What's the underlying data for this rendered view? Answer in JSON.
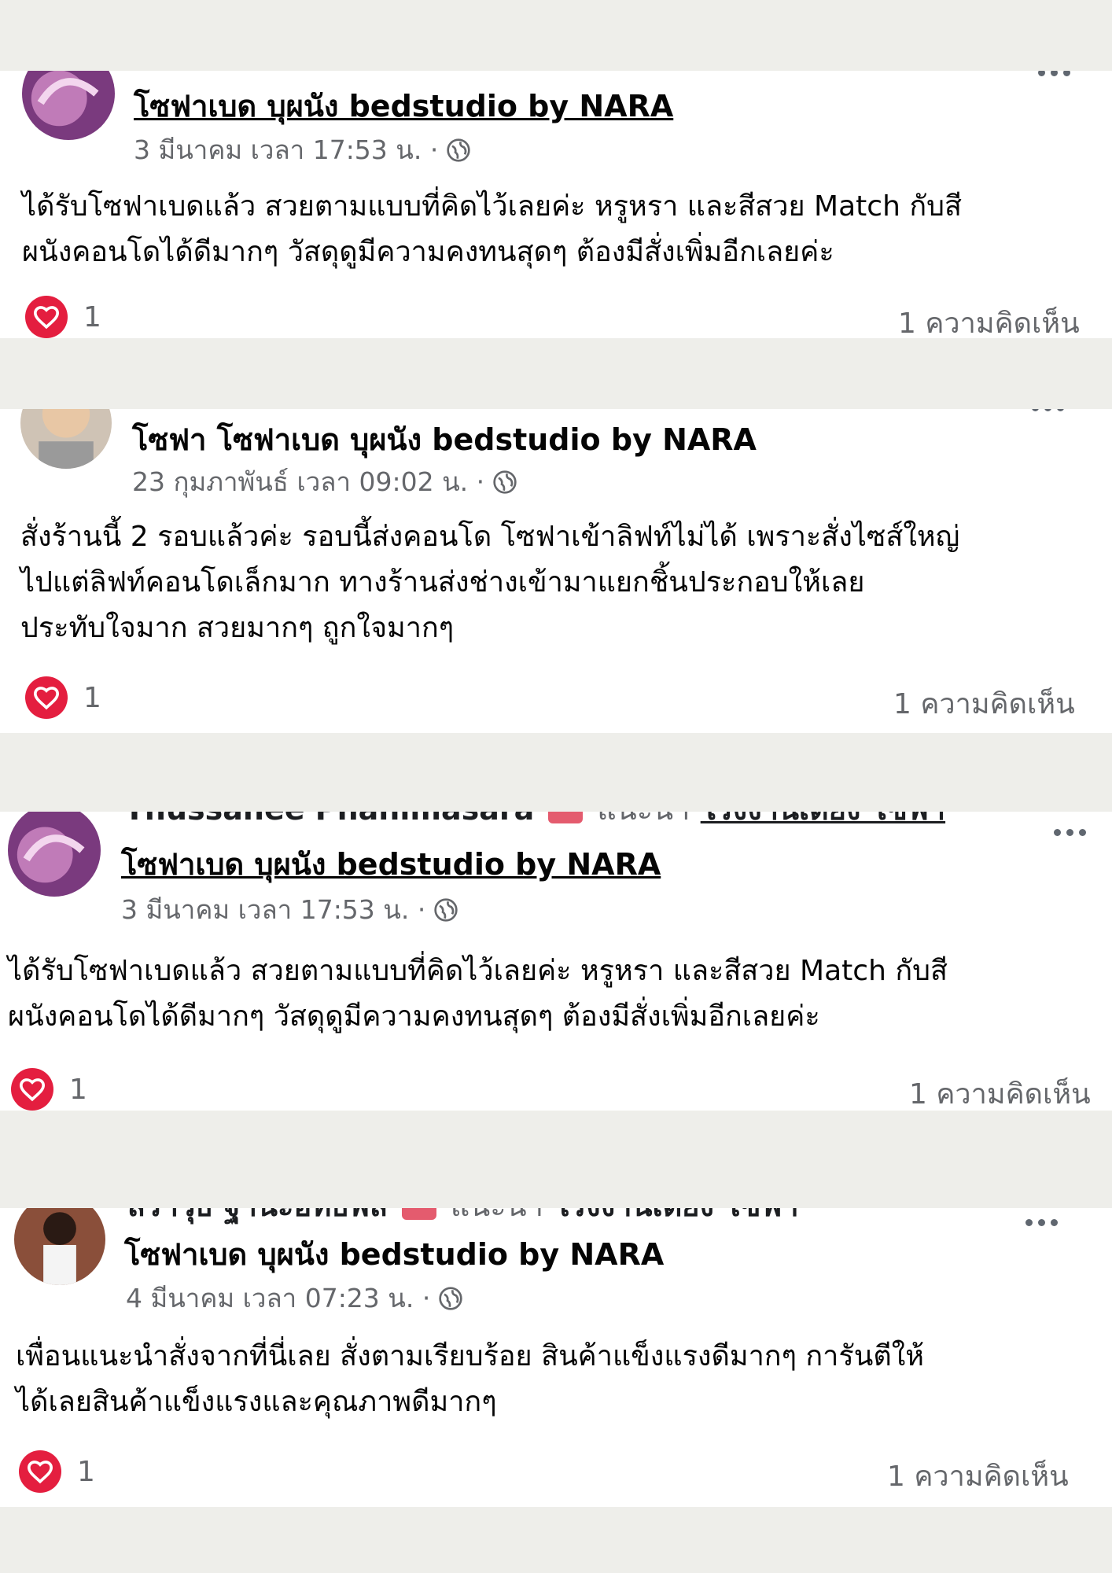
{
  "posts": [
    {
      "page_name": "โซฟาเบด บุผนัง bedstudio by NARA",
      "timestamp": "3 มีนาคม เวลา 17:53 น. ·",
      "lines": [
        "ได้รับโซฟาเบดแล้ว สวยตามแบบที่คิดไว้เลยค่ะ หรูหรา และสีสวย Match กับสี",
        "ผนังคอนโดได้ดีมากๆ วัสดุดูมีความคงทนสุดๆ ต้องมีสั่งเพิ่มอีกเลยค่ะ"
      ],
      "reactions": "1",
      "comments": "1 ความคิดเห็น"
    },
    {
      "page_name_prefix": "โซฟา",
      "page_name": "โซฟาเบด บุผนัง bedstudio by NARA",
      "timestamp": "23 กุมภาพันธ์ เวลา 09:02 น. ·",
      "lines": [
        "สั่งร้านนี้ 2 รอบแล้วค่ะ รอบนี้ส่งคอนโด โซฟาเข้าลิฟท์ไม่ได้ เพราะสั่งไซส์ใหญ่",
        "ไปแต่ลิฟท์คอนโดเล็กมาก ทางร้านส่งช่างเข้ามาแยกชิ้นประกอบให้เลย",
        "ประทับใจมาก สวยมากๆ ถูกใจมากๆ"
      ],
      "reactions": "1",
      "comments": "1 ความคิดเห็น"
    },
    {
      "cut_header": "Thussanee Phanimasara",
      "recommends_label": "แนะนำ",
      "recommends_target": "โรงงานเตียง โซฟา",
      "page_name": "โซฟาเบด บุผนัง bedstudio by NARA",
      "timestamp": "3 มีนาคม เวลา 17:53 น. ·",
      "lines": [
        "ได้รับโซฟาเบดแล้ว สวยตามแบบที่คิดไว้เลยค่ะ หรูหรา และสีสวย Match กับสี",
        "ผนังคอนโดได้ดีมากๆ วัสดุดูมีความคงทนสุดๆ ต้องมีสั่งเพิ่มอีกเลยค่ะ"
      ],
      "reactions": "1",
      "comments": "1 ความคิดเห็น"
    },
    {
      "cut_header": "สราวุธ ฐานะอิทธิพล",
      "recommends_label": "แนะนำ",
      "recommends_target": "โรงงานเตียง โซฟา",
      "page_name": "โซฟาเบด บุผนัง bedstudio by NARA",
      "timestamp": "4 มีนาคม เวลา 07:23 น. ·",
      "lines": [
        "เพื่อนแนะนำสั่งจากที่นี่เลย สั่งตามเรียบร้อย สินค้าแข็งแรงดีมากๆ  การันตีให้",
        "ได้เลยสินค้าแข็งแรงและคุณภาพดีมากๆ"
      ],
      "reactions": "1",
      "comments": "1 ความคิดเห็น"
    }
  ],
  "colors": {
    "background": "#eeeeea",
    "card": "#ffffff",
    "heart": "#e41e3f",
    "meta_text": "#65676b"
  },
  "icons": [
    "heart-icon",
    "globe-icon",
    "more-options-icon",
    "avatar"
  ]
}
